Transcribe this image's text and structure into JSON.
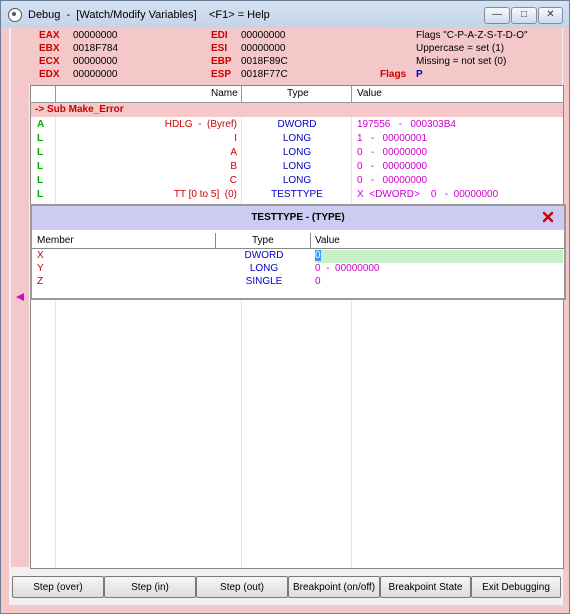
{
  "window": {
    "title": "Debug  -  [Watch/Modify Variables]    <F1> = Help",
    "minimize_glyph": "—",
    "maximize_glyph": "□",
    "close_glyph": "✕"
  },
  "registers": {
    "eax": {
      "name": "EAX",
      "value": "00000000"
    },
    "ebx": {
      "name": "EBX",
      "value": "0018F784"
    },
    "ecx": {
      "name": "ECX",
      "value": "00000000"
    },
    "edx": {
      "name": "EDX",
      "value": "00000000"
    },
    "edi": {
      "name": "EDI",
      "value": "00000000"
    },
    "esi": {
      "name": "ESI",
      "value": "00000000"
    },
    "ebp": {
      "name": "EBP",
      "value": "0018F89C"
    },
    "esp": {
      "name": "ESP",
      "value": "0018F77C"
    }
  },
  "flags": {
    "legend": "Flags \"C-P-A-Z-S-T-D-O\"",
    "uppercase": "Uppercase = set (1)",
    "missing": "Missing = not set (0)",
    "label": "Flags",
    "value": "P"
  },
  "grid": {
    "headers": {
      "name": "Name",
      "type": "Type",
      "value": "Value"
    },
    "sub_header": "-> Sub Make_Error",
    "rows": [
      {
        "kind": "A",
        "name": "HDLG  -  (Byref)",
        "type": "DWORD",
        "value": "197556   -   000303B4"
      },
      {
        "kind": "L",
        "name": "I",
        "type": "LONG",
        "value": "1   -   00000001"
      },
      {
        "kind": "L",
        "name": "A",
        "type": "LONG",
        "value": "0   -   00000000"
      },
      {
        "kind": "L",
        "name": "B",
        "type": "LONG",
        "value": "0   -   00000000"
      },
      {
        "kind": "L",
        "name": "C",
        "type": "LONG",
        "value": "0   -   00000000"
      },
      {
        "kind": "L",
        "name": "TT [0 to 5]  (0)",
        "type": "TESTTYPE",
        "value": "X  <DWORD>    0   -  00000000"
      }
    ]
  },
  "popup": {
    "title": "TESTTYPE   -   (TYPE)",
    "headers": {
      "member": "Member",
      "type": "Type",
      "value": "Value"
    },
    "rows": [
      {
        "member": "X",
        "type": "DWORD",
        "value": "0"
      },
      {
        "member": "Y",
        "type": "LONG",
        "value": "0  -  00000000"
      },
      {
        "member": "Z",
        "type": "SINGLE",
        "value": "0"
      }
    ]
  },
  "buttons": {
    "step_over": "Step (over)",
    "step_in": "Step (in)",
    "step_out": "Step (out)",
    "breakpoint_toggle": "Breakpoint (on/off)",
    "breakpoint_state": "Breakpoint State",
    "exit": "Exit Debugging"
  },
  "colors": {
    "register_name": "#cc0000",
    "panel_background": "#f4c8c8",
    "popup_header": "#ccccf2",
    "value_text": "#cc00cc",
    "type_text": "#0000cc",
    "kind_text": "#00aa00",
    "selected_value_background": "#c8f0c8"
  }
}
